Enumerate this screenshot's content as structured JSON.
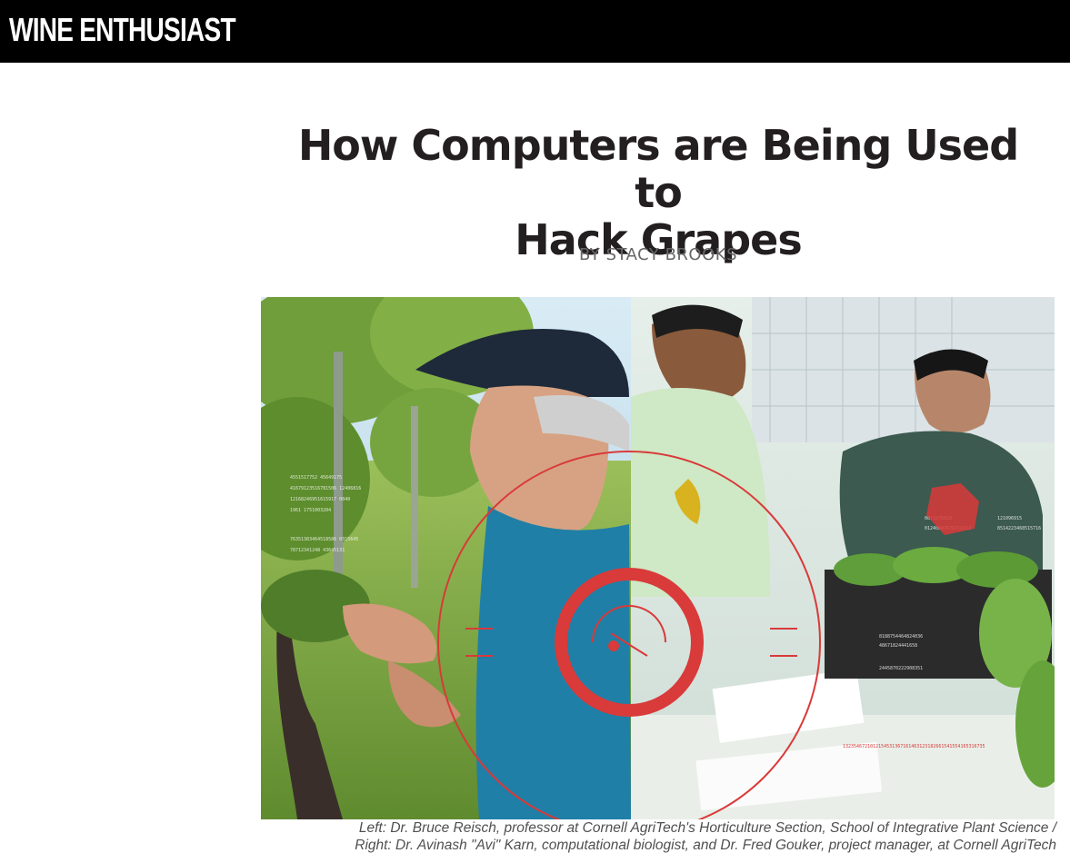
{
  "brand": {
    "name": "WINE ENTHUSIAST"
  },
  "article": {
    "title_line1": "How Computers are Being Used to",
    "title_line2": "Hack Grapes",
    "byline": "BY STACY BROOKS",
    "caption_line1": "Left: Dr. Bruce Reisch, professor at Cornell AgriTech's Horticulture Section, School of Integrative Plant Science /",
    "caption_line2": "Right: Dr. Avinash \"Avi\" Karn, computational biologist, and Dr. Fred Gouker, project manager, at Cornell AgriTech"
  },
  "colors": {
    "topbar": "#000000",
    "headline": "#231f20",
    "byline": "#676767",
    "target_overlay": "#d93a3a"
  }
}
